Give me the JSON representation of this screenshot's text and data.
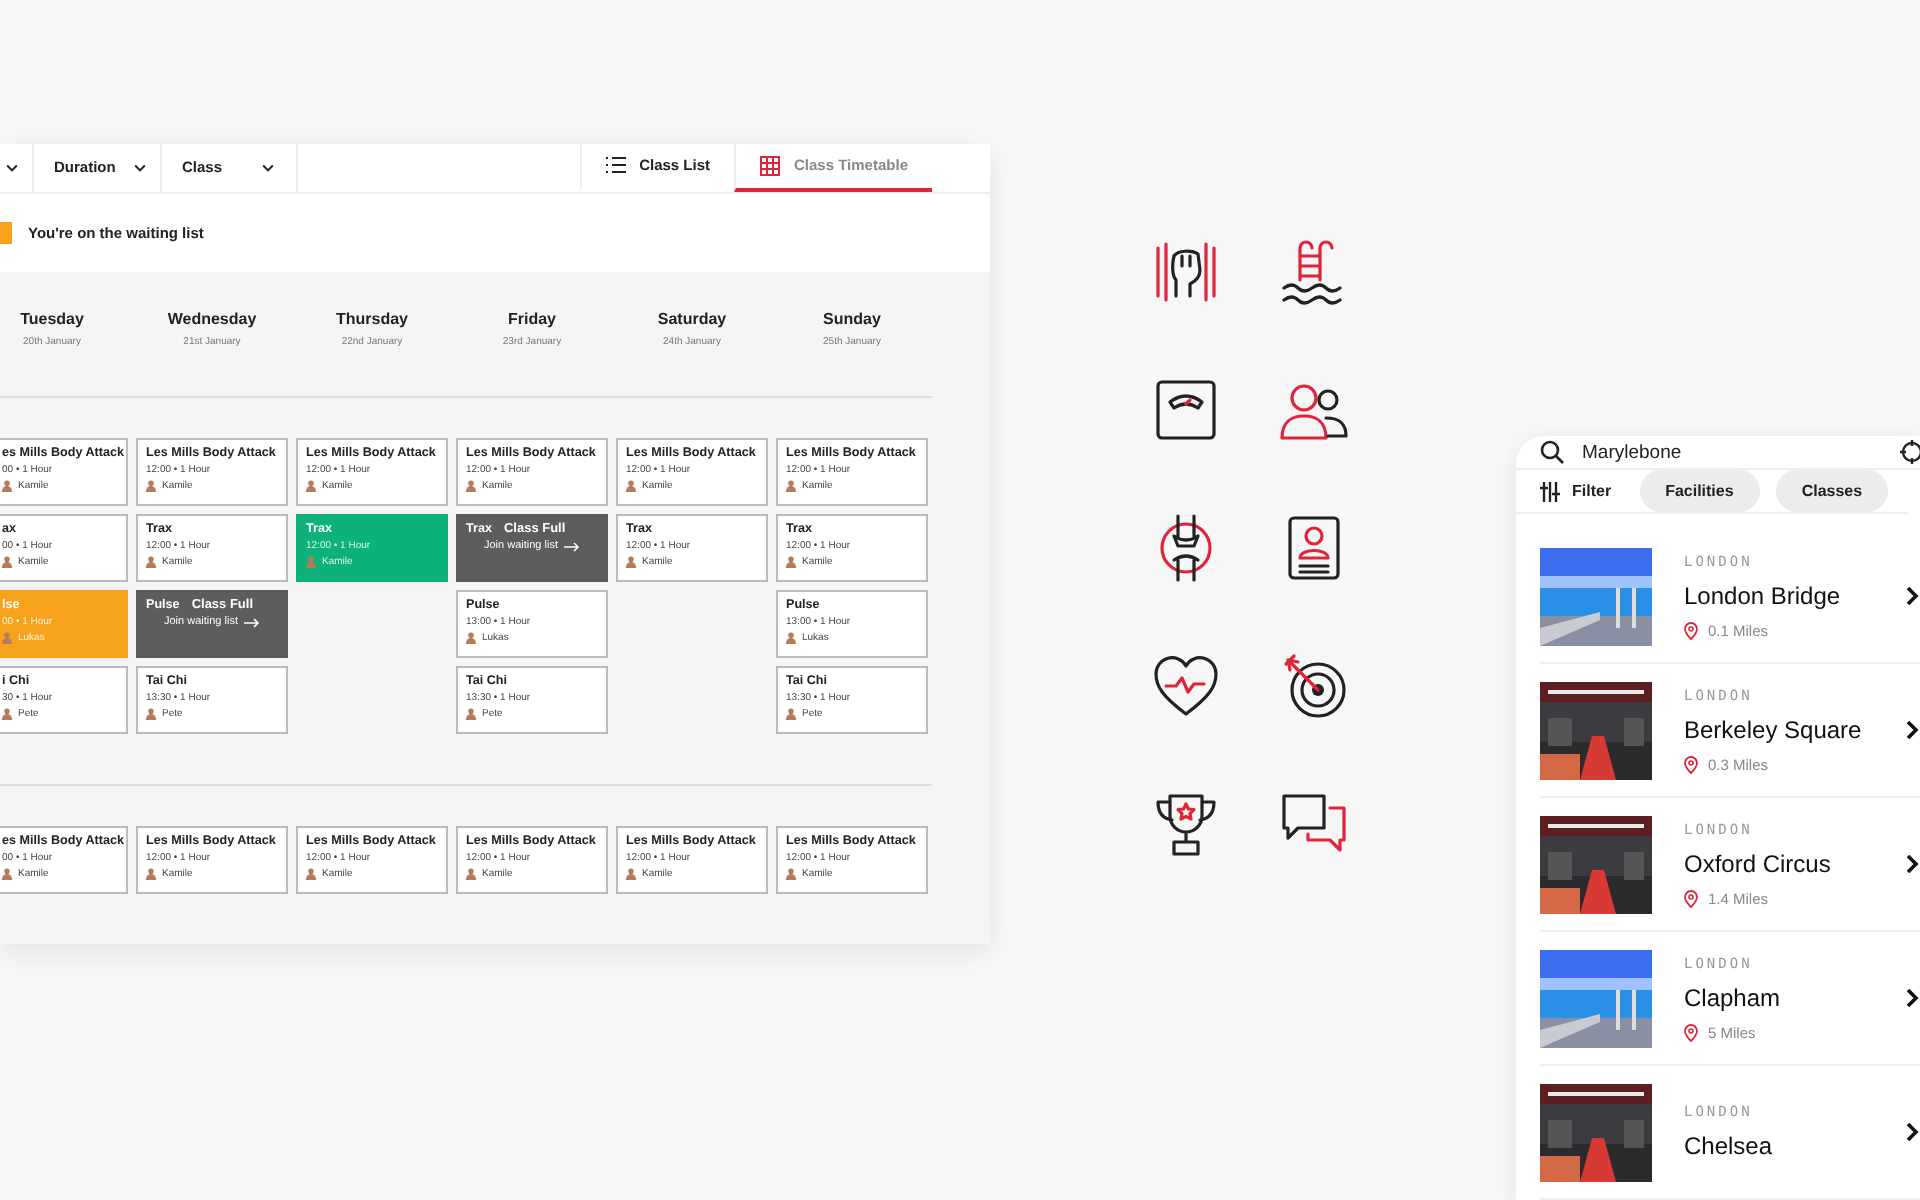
{
  "timetable": {
    "filters": [
      {
        "label": "Duration"
      },
      {
        "label": "Class"
      }
    ],
    "view_tabs": [
      {
        "label": "Class List",
        "selected": false
      },
      {
        "label": "Class Timetable",
        "selected": true
      }
    ],
    "legend": {
      "label": "You're on the waiting list"
    },
    "days": [
      {
        "name": "Tuesday",
        "date": "20th January"
      },
      {
        "name": "Wednesday",
        "date": "21st January"
      },
      {
        "name": "Thursday",
        "date": "22nd January"
      },
      {
        "name": "Friday",
        "date": "23rd January"
      },
      {
        "name": "Saturday",
        "date": "24th January"
      },
      {
        "name": "Sunday",
        "date": "25th January"
      }
    ],
    "blocks": [
      {
        "columns": [
          [
            {
              "kind": "normal",
              "title": "es Mills Body Attack",
              "time": "00 • 1 Hour",
              "instructor": "Kamile"
            },
            {
              "kind": "normal",
              "title": "ax",
              "time": "00 • 1 Hour",
              "instructor": "Kamile"
            },
            {
              "kind": "waiting",
              "title": "lse",
              "time": "00 • 1 Hour",
              "instructor": "Lukas"
            },
            {
              "kind": "normal",
              "title": "i Chi",
              "time": "30 • 1 Hour",
              "instructor": "Pete"
            }
          ],
          [
            {
              "kind": "normal",
              "title": "Les Mills Body Attack",
              "time": "12:00 • 1 Hour",
              "instructor": "Kamile"
            },
            {
              "kind": "normal",
              "title": "Trax",
              "time": "12:00 • 1 Hour",
              "instructor": "Kamile"
            },
            {
              "kind": "full",
              "title": "Pulse",
              "status": "Class Full",
              "action": "Join waiting list"
            },
            {
              "kind": "normal",
              "title": "Tai Chi",
              "time": "13:30 • 1 Hour",
              "instructor": "Pete"
            }
          ],
          [
            {
              "kind": "normal",
              "title": "Les Mills Body Attack",
              "time": "12:00 • 1 Hour",
              "instructor": "Kamile"
            },
            {
              "kind": "booked",
              "title": "Trax",
              "time": "12:00 • 1 Hour",
              "instructor": "Kamile"
            }
          ],
          [
            {
              "kind": "normal",
              "title": "Les Mills Body Attack",
              "time": "12:00 • 1 Hour",
              "instructor": "Kamile"
            },
            {
              "kind": "full",
              "title": "Trax",
              "status": "Class Full",
              "action": "Join waiting list"
            },
            {
              "kind": "normal",
              "title": "Pulse",
              "time": "13:00 • 1 Hour",
              "instructor": "Lukas"
            },
            {
              "kind": "normal",
              "title": "Tai Chi",
              "time": "13:30 • 1 Hour",
              "instructor": "Pete"
            }
          ],
          [
            {
              "kind": "normal",
              "title": "Les Mills Body Attack",
              "time": "12:00 • 1 Hour",
              "instructor": "Kamile"
            },
            {
              "kind": "normal",
              "title": "Trax",
              "time": "12:00 • 1 Hour",
              "instructor": "Kamile"
            }
          ],
          [
            {
              "kind": "normal",
              "title": "Les Mills Body Attack",
              "time": "12:00 • 1 Hour",
              "instructor": "Kamile"
            },
            {
              "kind": "normal",
              "title": "Trax",
              "time": "12:00 • 1 Hour",
              "instructor": "Kamile"
            },
            {
              "kind": "normal",
              "title": "Pulse",
              "time": "13:00 • 1 Hour",
              "instructor": "Lukas"
            },
            {
              "kind": "normal",
              "title": "Tai Chi",
              "time": "13:30 • 1 Hour",
              "instructor": "Pete"
            }
          ]
        ]
      },
      {
        "columns": [
          [
            {
              "kind": "normal",
              "title": "es Mills Body Attack",
              "time": "00 • 1 Hour",
              "instructor": "Kamile"
            }
          ],
          [
            {
              "kind": "normal",
              "title": "Les Mills Body Attack",
              "time": "12:00 • 1 Hour",
              "instructor": "Kamile"
            }
          ],
          [
            {
              "kind": "normal",
              "title": "Les Mills Body Attack",
              "time": "12:00 • 1 Hour",
              "instructor": "Kamile"
            }
          ],
          [
            {
              "kind": "normal",
              "title": "Les Mills Body Attack",
              "time": "12:00 • 1 Hour",
              "instructor": "Kamile"
            }
          ],
          [
            {
              "kind": "normal",
              "title": "Les Mills Body Attack",
              "time": "12:00 • 1 Hour",
              "instructor": "Kamile"
            }
          ],
          [
            {
              "kind": "normal",
              "title": "Les Mills Body Attack",
              "time": "12:00 • 1 Hour",
              "instructor": "Kamile"
            }
          ]
        ]
      }
    ]
  },
  "app": {
    "search": {
      "value": "Marylebone"
    },
    "filter": {
      "label": "Filter"
    },
    "chips": [
      {
        "label": "Facilities"
      },
      {
        "label": "Classes"
      }
    ],
    "locations": [
      {
        "region": "LONDON",
        "name": "London Bridge",
        "distance": "0.1 Miles"
      },
      {
        "region": "LONDON",
        "name": "Berkeley Square",
        "distance": "0.3 Miles"
      },
      {
        "region": "LONDON",
        "name": "Oxford Circus",
        "distance": "1.4 Miles"
      },
      {
        "region": "LONDON",
        "name": "Clapham",
        "distance": "5 Miles"
      },
      {
        "region": "LONDON",
        "name": "Chelsea"
      }
    ]
  }
}
